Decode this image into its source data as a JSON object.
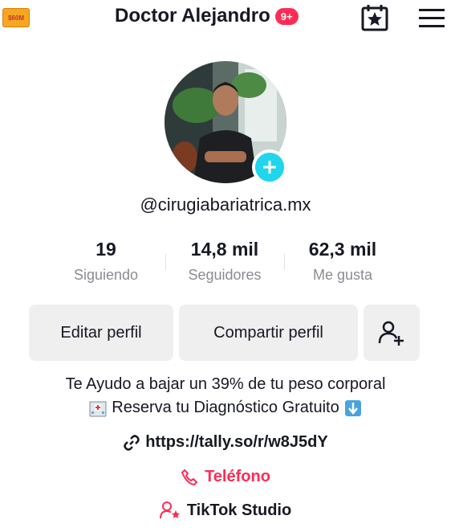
{
  "header": {
    "title": "Doctor Alejandro",
    "notification_badge": "9+",
    "coin_label": "$60M",
    "left_icon": "coin-icon",
    "calendar_icon": "calendar-star-icon",
    "menu_icon": "hamburger-menu-icon"
  },
  "profile": {
    "handle": "@cirugiabariatrica.mx",
    "avatar_icon": "avatar",
    "add_icon": "plus-icon"
  },
  "stats": [
    {
      "value": "19",
      "label": "Siguiendo"
    },
    {
      "value": "14,8 mil",
      "label": "Seguidores"
    },
    {
      "value": "62,3 mil",
      "label": "Me gusta"
    }
  ],
  "actions": {
    "edit_label": "Editar perfil",
    "share_label": "Compartir perfil",
    "add_friend_icon": "add-user-icon"
  },
  "bio": {
    "line1": "Te Ayudo a bajar un 39% de tu peso corporal",
    "line2": "Reserva tu Diagnóstico Gratuito",
    "link": "https://tally.so/r/w8J5dY",
    "phone_label": "Teléfono",
    "studio_label": "TikTok Studio"
  },
  "colors": {
    "accent": "#fe2c55",
    "plus": "#20d5ec",
    "button_bg": "#efefef",
    "muted_text": "#8a8b91"
  }
}
